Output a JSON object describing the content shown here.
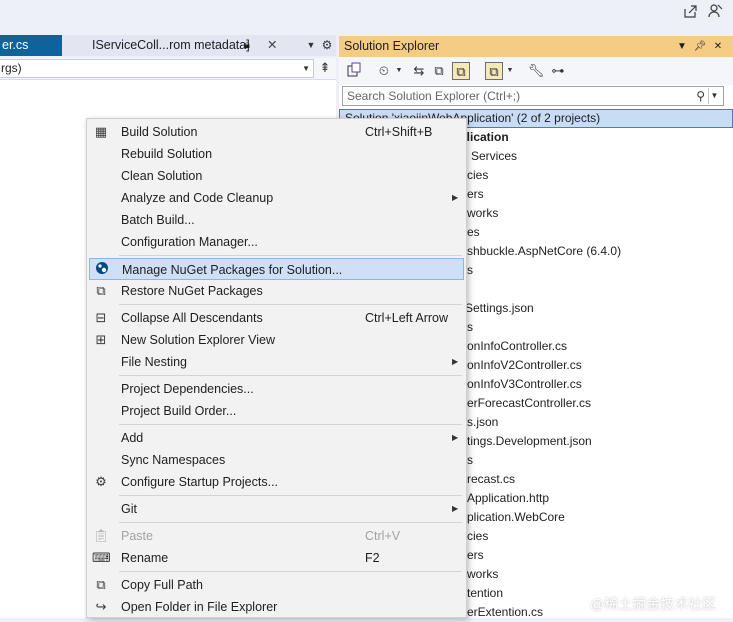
{
  "top_bar": {
    "share_icon": "share-icon",
    "feedback_icon": "feedback-person-icon"
  },
  "editor": {
    "active_tab": "er.cs",
    "preview_tab": "IServiceColl...rom metadata]",
    "member_dropdown": "rgs)"
  },
  "solution_explorer": {
    "title": "Solution Explorer",
    "search_placeholder": "Search Solution Explorer (Ctrl+;)",
    "tree": [
      {
        "text": "Solution 'xiaojinWebApplication' (2 of 2 projects)",
        "bold": false,
        "selected": true
      },
      {
        "text": "pplication",
        "bold": true,
        "selected": false
      },
      {
        "text": "Services",
        "bold": false,
        "selected": false
      },
      {
        "text": "cies",
        "bold": false,
        "selected": false
      },
      {
        "text": "ers",
        "bold": false,
        "selected": false
      },
      {
        "text": "works",
        "bold": false,
        "selected": false
      },
      {
        "text": "es",
        "bold": false,
        "selected": false
      },
      {
        "text": "shbuckle.AspNetCore (6.4.0)",
        "bold": false,
        "selected": false
      },
      {
        "text": "s",
        "bold": false,
        "selected": false
      },
      {
        "text": "",
        "bold": false,
        "selected": false
      },
      {
        "text": "Settings.json",
        "bold": false,
        "selected": false
      },
      {
        "text": "s",
        "bold": false,
        "selected": false
      },
      {
        "text": "onInfoController.cs",
        "bold": false,
        "selected": false
      },
      {
        "text": "onInfoV2Controller.cs",
        "bold": false,
        "selected": false
      },
      {
        "text": "onInfoV3Controller.cs",
        "bold": false,
        "selected": false
      },
      {
        "text": "erForecastController.cs",
        "bold": false,
        "selected": false
      },
      {
        "text": "s.json",
        "bold": false,
        "selected": false
      },
      {
        "text": "tings.Development.json",
        "bold": false,
        "selected": false
      },
      {
        "text": "s",
        "bold": false,
        "selected": false
      },
      {
        "text": "recast.cs",
        "bold": false,
        "selected": false
      },
      {
        "text": "Application.http",
        "bold": false,
        "selected": false
      },
      {
        "text": "plication.WebCore",
        "bold": false,
        "selected": false
      },
      {
        "text": "cies",
        "bold": false,
        "selected": false
      },
      {
        "text": "ers",
        "bold": false,
        "selected": false
      },
      {
        "text": "works",
        "bold": false,
        "selected": false
      },
      {
        "text": "tention",
        "bold": false,
        "selected": false
      },
      {
        "text": "erExtention.cs",
        "bold": false,
        "selected": false
      }
    ]
  },
  "context_menu": {
    "items": [
      {
        "label": "Build Solution",
        "shortcut": "Ctrl+Shift+B",
        "icon": "build-icon",
        "submenu": false,
        "disabled": false,
        "highlight": false
      },
      {
        "label": "Rebuild Solution",
        "shortcut": "",
        "icon": "",
        "submenu": false,
        "disabled": false,
        "highlight": false
      },
      {
        "label": "Clean Solution",
        "shortcut": "",
        "icon": "",
        "submenu": false,
        "disabled": false,
        "highlight": false
      },
      {
        "label": "Analyze and Code Cleanup",
        "shortcut": "",
        "icon": "",
        "submenu": true,
        "disabled": false,
        "highlight": false
      },
      {
        "label": "Batch Build...",
        "shortcut": "",
        "icon": "",
        "submenu": false,
        "disabled": false,
        "highlight": false
      },
      {
        "label": "Configuration Manager...",
        "shortcut": "",
        "icon": "",
        "submenu": false,
        "disabled": false,
        "highlight": false
      },
      {
        "label": "Manage NuGet Packages for Solution...",
        "shortcut": "",
        "icon": "nuget-icon",
        "submenu": false,
        "disabled": false,
        "highlight": true
      },
      {
        "label": "Restore NuGet Packages",
        "shortcut": "",
        "icon": "restore-packages-icon",
        "submenu": false,
        "disabled": false,
        "highlight": false
      },
      {
        "label": "Collapse All Descendants",
        "shortcut": "Ctrl+Left Arrow",
        "icon": "collapse-icon",
        "submenu": false,
        "disabled": false,
        "highlight": false
      },
      {
        "label": "New Solution Explorer View",
        "shortcut": "",
        "icon": "new-view-icon",
        "submenu": false,
        "disabled": false,
        "highlight": false
      },
      {
        "label": "File Nesting",
        "shortcut": "",
        "icon": "",
        "submenu": true,
        "disabled": false,
        "highlight": false
      },
      {
        "label": "Project Dependencies...",
        "shortcut": "",
        "icon": "",
        "submenu": false,
        "disabled": false,
        "highlight": false
      },
      {
        "label": "Project Build Order...",
        "shortcut": "",
        "icon": "",
        "submenu": false,
        "disabled": false,
        "highlight": false
      },
      {
        "label": "Add",
        "shortcut": "",
        "icon": "",
        "submenu": true,
        "disabled": false,
        "highlight": false
      },
      {
        "label": "Sync Namespaces",
        "shortcut": "",
        "icon": "",
        "submenu": false,
        "disabled": false,
        "highlight": false
      },
      {
        "label": "Configure Startup Projects...",
        "shortcut": "",
        "icon": "gear-icon",
        "submenu": false,
        "disabled": false,
        "highlight": false
      },
      {
        "label": "Git",
        "shortcut": "",
        "icon": "",
        "submenu": true,
        "disabled": false,
        "highlight": false
      },
      {
        "label": "Paste",
        "shortcut": "Ctrl+V",
        "icon": "paste-icon",
        "submenu": false,
        "disabled": true,
        "highlight": false
      },
      {
        "label": "Rename",
        "shortcut": "F2",
        "icon": "rename-icon",
        "submenu": false,
        "disabled": false,
        "highlight": false
      },
      {
        "label": "Copy Full Path",
        "shortcut": "",
        "icon": "copy-icon",
        "submenu": false,
        "disabled": false,
        "highlight": false
      },
      {
        "label": "Open Folder in File Explorer",
        "shortcut": "",
        "icon": "open-folder-icon",
        "submenu": false,
        "disabled": false,
        "highlight": false
      }
    ]
  },
  "watermark": "@稀土掘金技术社区",
  "colors": {
    "accent_tab": "#0e639c",
    "panel_title": "#f5cc84",
    "menu_highlight": "#cde0f7",
    "tree_selected": "#c9dcf5"
  }
}
